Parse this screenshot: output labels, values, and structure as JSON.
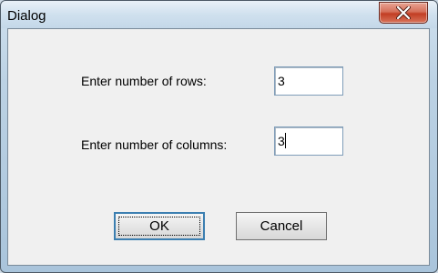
{
  "window": {
    "title": "Dialog",
    "close_icon": "close-x-icon"
  },
  "form": {
    "rows_label": "Enter number of rows:",
    "rows_value": "3",
    "columns_label": "Enter number of columns:",
    "columns_value": "3"
  },
  "buttons": {
    "ok_label": "OK",
    "cancel_label": "Cancel"
  }
}
